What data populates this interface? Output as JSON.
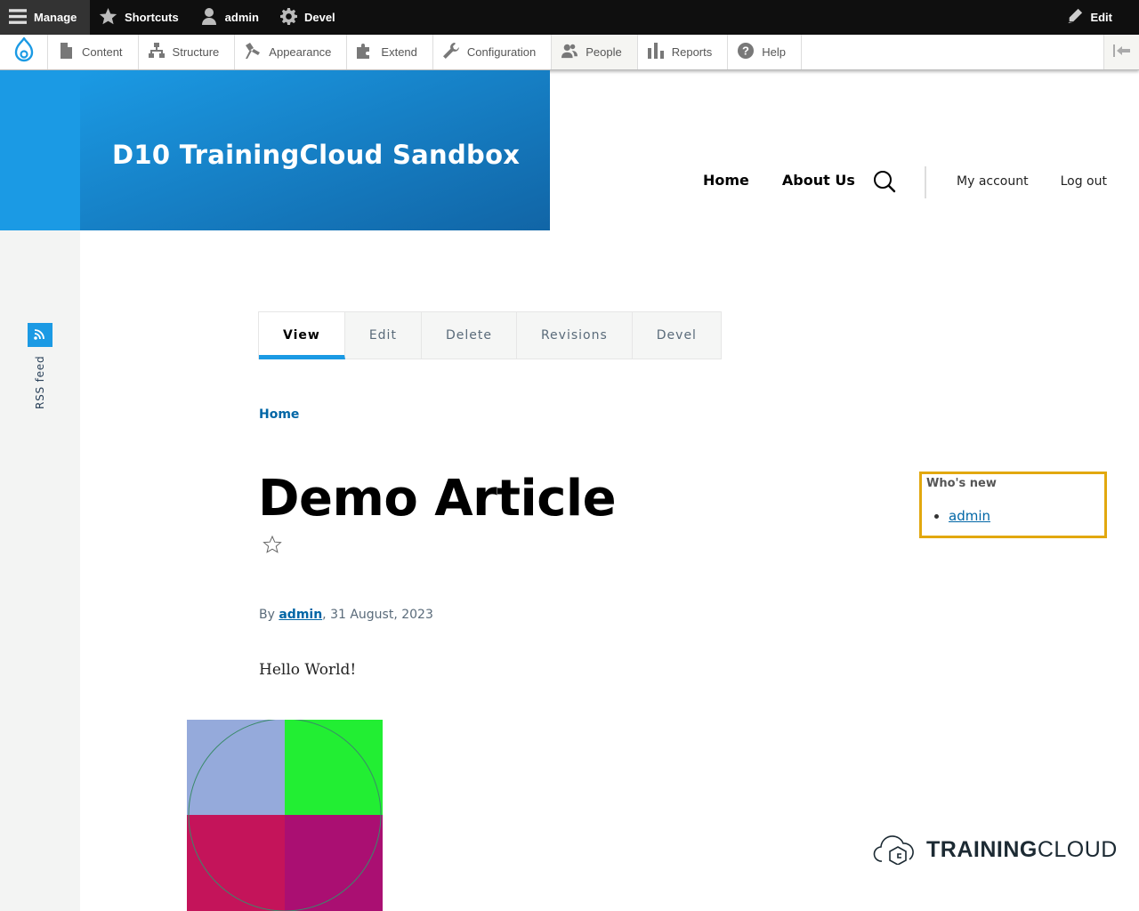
{
  "toolbar": {
    "manage": "Manage",
    "shortcuts": "Shortcuts",
    "user": "admin",
    "devel": "Devel",
    "edit": "Edit"
  },
  "tray": {
    "items": [
      "Content",
      "Structure",
      "Appearance",
      "Extend",
      "Configuration",
      "People",
      "Reports",
      "Help"
    ]
  },
  "site": {
    "name": "D10 TrainingCloud Sandbox",
    "brand_color": "#1b9ae4"
  },
  "main_nav": [
    "Home",
    "About Us"
  ],
  "account_nav": [
    "My account",
    "Log out"
  ],
  "rss": {
    "label": "RSS feed"
  },
  "tabs": [
    {
      "label": "View",
      "active": true
    },
    {
      "label": "Edit",
      "active": false
    },
    {
      "label": "Delete",
      "active": false
    },
    {
      "label": "Revisions",
      "active": false
    },
    {
      "label": "Devel",
      "active": false
    }
  ],
  "breadcrumb": "Home",
  "article": {
    "title": "Demo Article",
    "byline_prefix": "By",
    "author": "admin",
    "date": ", 31 August, 2023",
    "body": "Hello World!"
  },
  "whos_new": {
    "title": "Who's new",
    "users": [
      "admin"
    ]
  },
  "footer_logo": {
    "bold": "TRAINING",
    "light": "CLOUD"
  }
}
